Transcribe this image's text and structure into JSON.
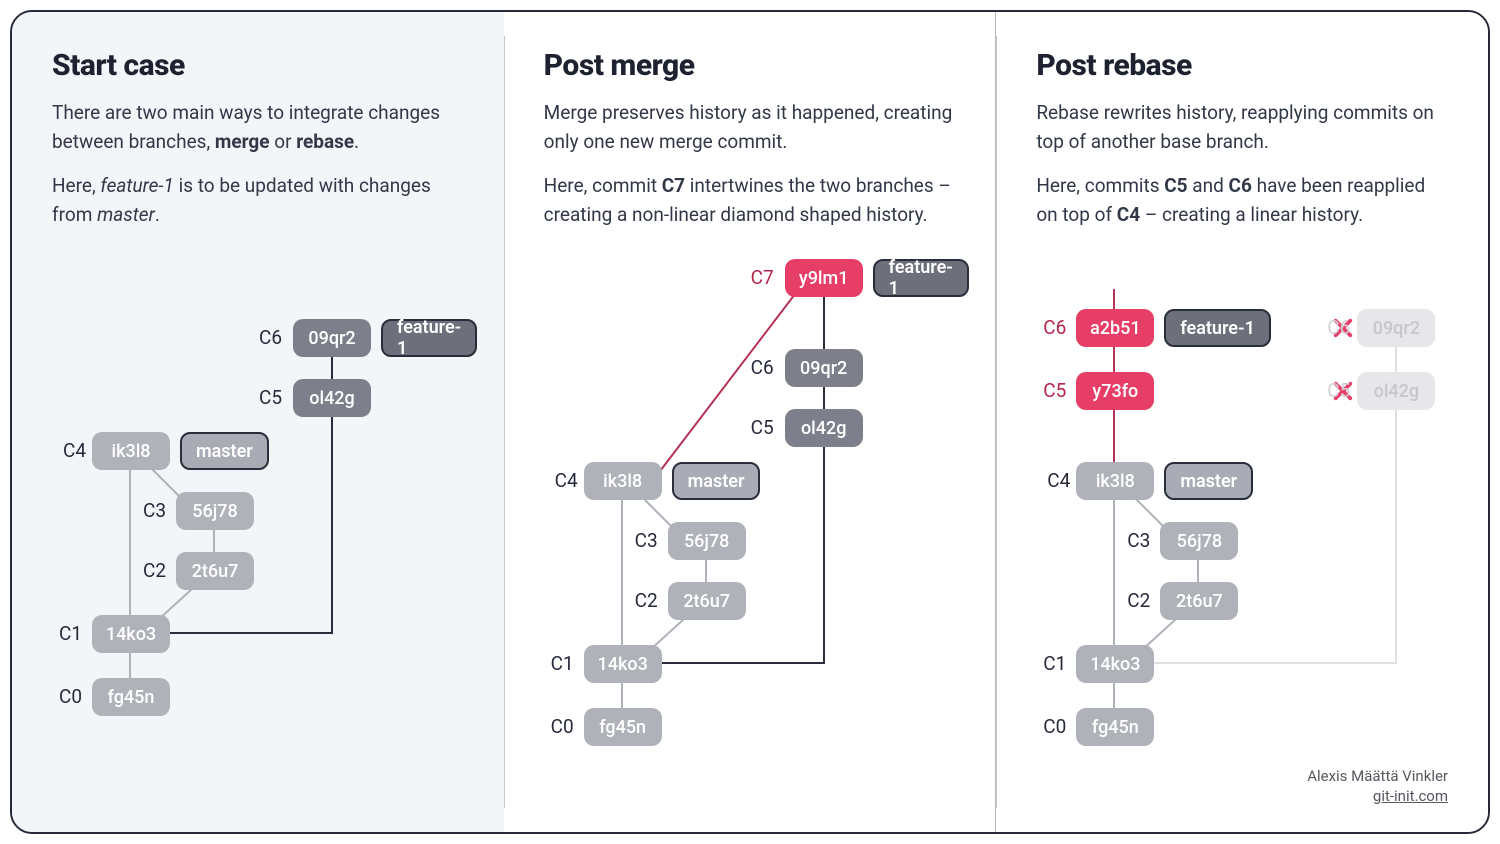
{
  "panels": {
    "start": {
      "title": "Start case",
      "p1_html": "There are two main ways to integrate changes between branches, <b>merge</b> or <b>rebase</b>.",
      "p2_html": "Here, <i>feature-1</i> is to be updated with changes from <i>master</i>."
    },
    "merge": {
      "title": "Post merge",
      "p1_html": "Merge preserves history as it happened, creating only one new merge commit.",
      "p2_html": "Here, commit <b>C7</b> intertwines the two branches – creating a non-linear diamond shaped history."
    },
    "rebase": {
      "title": "Post rebase",
      "p1_html": "Rebase rewrites history, reapplying commits on top of another base branch.",
      "p2_html": "Here, commits <b>C5</b> and <b>C6</b> have been reapplied on top of <b>C4</b> – creating a linear history."
    }
  },
  "branches": {
    "master": "master",
    "feature": "feature-1"
  },
  "commits": {
    "c0": {
      "label": "C0",
      "hash": "fg45n"
    },
    "c1": {
      "label": "C1",
      "hash": "14ko3"
    },
    "c2": {
      "label": "C2",
      "hash": "2t6u7"
    },
    "c3": {
      "label": "C3",
      "hash": "56j78"
    },
    "c4": {
      "label": "C4",
      "hash": "ik3l8"
    },
    "c5": {
      "label": "C5",
      "hash": "ol42g"
    },
    "c6": {
      "label": "C6",
      "hash": "09qr2"
    },
    "c7": {
      "label": "C7",
      "hash": "y9lm1"
    },
    "c5r": {
      "label": "C5",
      "hash": "y73fo"
    },
    "c6r": {
      "label": "C6",
      "hash": "a2b51"
    }
  },
  "attribution": {
    "author": "Alexis Määttä Vinkler",
    "site": "git-init.com"
  }
}
